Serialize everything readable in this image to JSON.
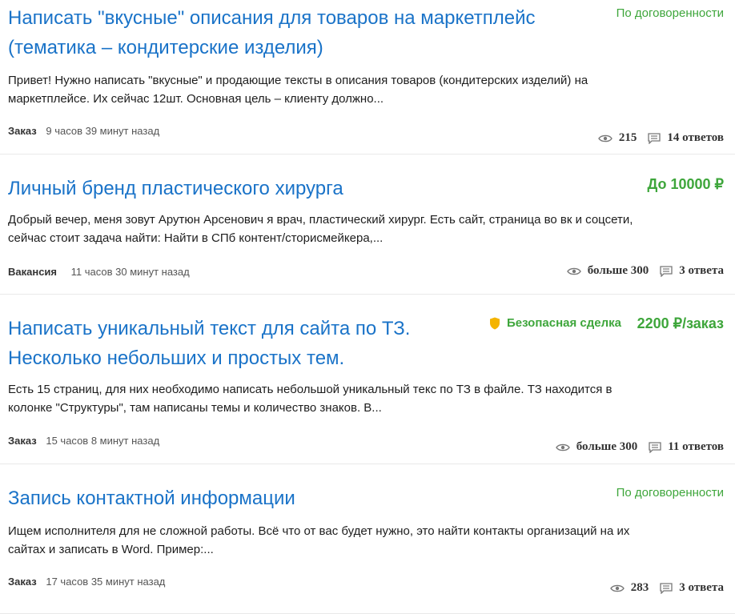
{
  "jobs": [
    {
      "title_line1": "Написать \"вкусные\" описания для товаров на маркетплейс",
      "title_line2": "(тематика – кондитерские изделия)",
      "price": "По договоренности",
      "description_line1": "Привет! Нужно написать \"вкусные\" и продающие тексты в описания товаров (кондитерских изделий) на",
      "description_line2": "маркетплейсе. Их сейчас 12шт. Основная цель – клиенту должно...",
      "type": "Заказ",
      "time": "9 часов 39 минут назад",
      "views": "215",
      "responses": "14 ответов"
    },
    {
      "title_line1": "Личный бренд пластического хирурга",
      "price": "До 10000 ₽",
      "description_line1": "Добрый вечер, меня зовут Арутюн Арсенович я врач, пластический хирург. Есть сайт, страница во вк и соцсети,",
      "description_line2": "сейчас стоит задача найти:  Найти в СПб контент/сторисмейкера,...",
      "type": "Вакансия",
      "time": "11 часов 30 минут назад",
      "views": "больше 300",
      "responses": "3 ответа"
    },
    {
      "title_line1": "Написать уникальный текст для сайта по ТЗ.",
      "title_line2": "Несколько небольших и простых тем.",
      "safe_deal": "Безопасная сделка",
      "price": "2200 ₽/заказ",
      "description_line1": "Есть 15 страниц, для них необходимо написать небольшой уникальный текс по ТЗ в файле. ТЗ находится в",
      "description_line2": "колонке \"Структуры\", там написаны темы и количество знаков. В...",
      "type": "Заказ",
      "time": "15 часов 8 минут назад",
      "views": "больше 300",
      "responses": "11 ответов"
    },
    {
      "title_line1": "Запись контактной информации",
      "price": "По договоренности",
      "description_line1": "Ищем исполнителя для не сложной работы. Всё что от вас будет нужно, это найти контакты организаций на их",
      "description_line2": "сайтах и записать в Word. Пример:...",
      "type": "Заказ",
      "time": "17 часов 35 минут назад",
      "views": "283",
      "responses": "3 ответа"
    }
  ],
  "icons": {
    "views": "eye-icon",
    "responses": "comment-icon",
    "safe_deal": "shield-icon"
  },
  "colors": {
    "link": "#1a73c8",
    "price": "#3ea63b",
    "shield": "#f4b400"
  }
}
